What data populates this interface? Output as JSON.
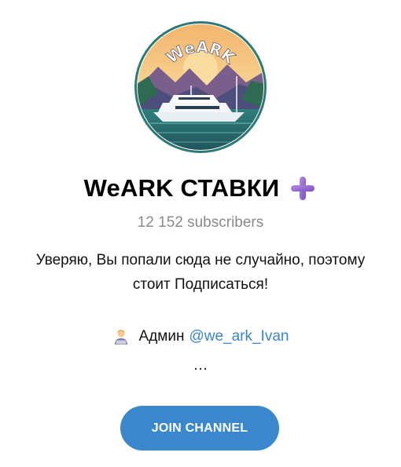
{
  "channel": {
    "avatar_text": "WeARK",
    "title": "WeARK СТАВКИ",
    "title_emoji": "purple-heavy-plus-icon",
    "subscribers": "12 152 subscribers",
    "description_line1": "Уверяю, Вы попали сюда не случайно, поэтому",
    "description_line2": "стоит Подписаться!",
    "admin_label": "Админ",
    "admin_link": "@we_ark_Ivan",
    "ellipsis": "…",
    "admin_icon": "technologist-emoji-icon"
  },
  "actions": {
    "join_label": "JOIN CHANNEL"
  },
  "colors": {
    "accent": "#3a87ce",
    "link": "#3a85c6",
    "muted": "#8a8a8a"
  }
}
